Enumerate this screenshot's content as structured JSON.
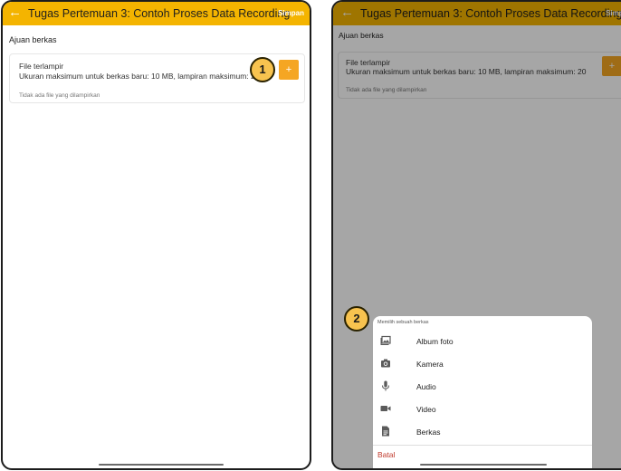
{
  "app": {
    "title": "Tugas Pertemuan 3: Contoh Proses Data Recording",
    "save_label": "Simpan",
    "back_icon": "←"
  },
  "submission": {
    "heading": "Ajuan berkas",
    "attachment_label": "File terlampir",
    "attachment_desc": "Ukuran maksimum untuk berkas baru: 10 MB, lampiran maksimum: 20",
    "no_file_text": "Tidak ada file yang dilampirkan",
    "add_label": "+"
  },
  "badges": {
    "one": "1",
    "two": "2"
  },
  "sheet": {
    "heading": "Memilih sebuah berkas",
    "options": [
      {
        "label": "Album foto",
        "icon": "photo-album-icon"
      },
      {
        "label": "Kamera",
        "icon": "camera-icon"
      },
      {
        "label": "Audio",
        "icon": "microphone-icon"
      },
      {
        "label": "Video",
        "icon": "video-icon"
      },
      {
        "label": "Berkas",
        "icon": "file-icon"
      }
    ],
    "cancel_label": "Batal"
  },
  "colors": {
    "appbar": "#f4b400",
    "add_button": "#f5a623",
    "badge": "#f8c34f",
    "cancel": "#c0392b"
  }
}
